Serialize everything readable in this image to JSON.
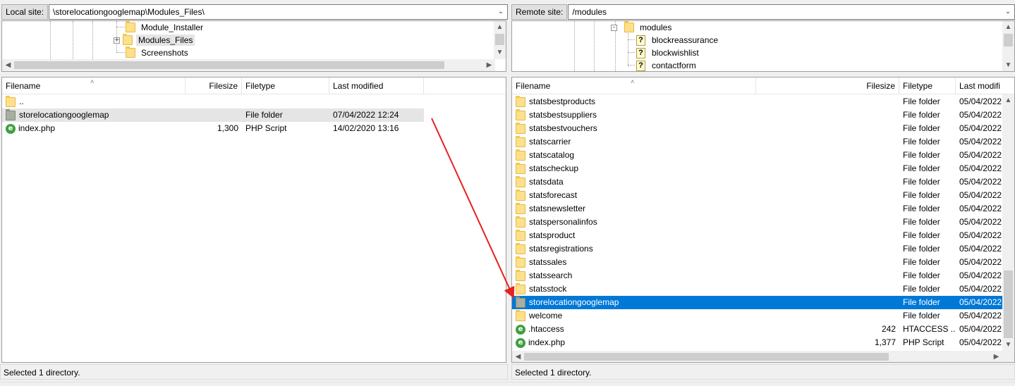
{
  "local": {
    "site_label": "Local site:",
    "site_path": "\\storelocationgooglemap\\Modules_Files\\",
    "tree": [
      {
        "label": "Module_Installer"
      },
      {
        "label": "Modules_Files",
        "selected": true
      },
      {
        "label": "Screenshots"
      }
    ],
    "columns": [
      "Filename",
      "Filesize",
      "Filetype",
      "Last modified"
    ],
    "rows": [
      {
        "name": "..",
        "size": "",
        "type": "",
        "modified": "",
        "icon": "folder"
      },
      {
        "name": "storelocationgooglemap",
        "size": "",
        "type": "File folder",
        "modified": "07/04/2022 12:24",
        "icon": "folder-dark"
      },
      {
        "name": "index.php",
        "size": "1,300",
        "type": "PHP Script",
        "modified": "14/02/2020 13:16",
        "icon": "php"
      }
    ],
    "status": "Selected 1 directory."
  },
  "remote": {
    "site_label": "Remote site:",
    "site_path": "/modules",
    "tree": [
      {
        "label": "modules"
      },
      {
        "label": "blockreassurance"
      },
      {
        "label": "blockwishlist"
      },
      {
        "label": "contactform"
      }
    ],
    "columns": [
      "Filename",
      "Filesize",
      "Filetype",
      "Last modifi"
    ],
    "rows": [
      {
        "name": "statsbestproducts",
        "size": "",
        "type": "File folder",
        "modified": "05/04/2022",
        "icon": "folder"
      },
      {
        "name": "statsbestsuppliers",
        "size": "",
        "type": "File folder",
        "modified": "05/04/2022",
        "icon": "folder"
      },
      {
        "name": "statsbestvouchers",
        "size": "",
        "type": "File folder",
        "modified": "05/04/2022",
        "icon": "folder"
      },
      {
        "name": "statscarrier",
        "size": "",
        "type": "File folder",
        "modified": "05/04/2022",
        "icon": "folder"
      },
      {
        "name": "statscatalog",
        "size": "",
        "type": "File folder",
        "modified": "05/04/2022",
        "icon": "folder"
      },
      {
        "name": "statscheckup",
        "size": "",
        "type": "File folder",
        "modified": "05/04/2022",
        "icon": "folder"
      },
      {
        "name": "statsdata",
        "size": "",
        "type": "File folder",
        "modified": "05/04/2022",
        "icon": "folder"
      },
      {
        "name": "statsforecast",
        "size": "",
        "type": "File folder",
        "modified": "05/04/2022",
        "icon": "folder"
      },
      {
        "name": "statsnewsletter",
        "size": "",
        "type": "File folder",
        "modified": "05/04/2022",
        "icon": "folder"
      },
      {
        "name": "statspersonalinfos",
        "size": "",
        "type": "File folder",
        "modified": "05/04/2022",
        "icon": "folder"
      },
      {
        "name": "statsproduct",
        "size": "",
        "type": "File folder",
        "modified": "05/04/2022",
        "icon": "folder"
      },
      {
        "name": "statsregistrations",
        "size": "",
        "type": "File folder",
        "modified": "05/04/2022",
        "icon": "folder"
      },
      {
        "name": "statssales",
        "size": "",
        "type": "File folder",
        "modified": "05/04/2022",
        "icon": "folder"
      },
      {
        "name": "statssearch",
        "size": "",
        "type": "File folder",
        "modified": "05/04/2022",
        "icon": "folder"
      },
      {
        "name": "statsstock",
        "size": "",
        "type": "File folder",
        "modified": "05/04/2022",
        "icon": "folder"
      },
      {
        "name": "storelocationgooglemap",
        "size": "",
        "type": "File folder",
        "modified": "05/04/2022",
        "icon": "folder-dark",
        "selected": true
      },
      {
        "name": "welcome",
        "size": "",
        "type": "File folder",
        "modified": "05/04/2022",
        "icon": "folder"
      },
      {
        "name": ".htaccess",
        "size": "242",
        "type": "HTACCESS ...",
        "modified": "05/04/2022",
        "icon": "php"
      },
      {
        "name": "index.php",
        "size": "1,377",
        "type": "PHP Script",
        "modified": "05/04/2022",
        "icon": "php"
      }
    ],
    "status": "Selected 1 directory."
  },
  "colors": {
    "selection": "#0078d7",
    "annotation_arrow": "#e8201f"
  }
}
